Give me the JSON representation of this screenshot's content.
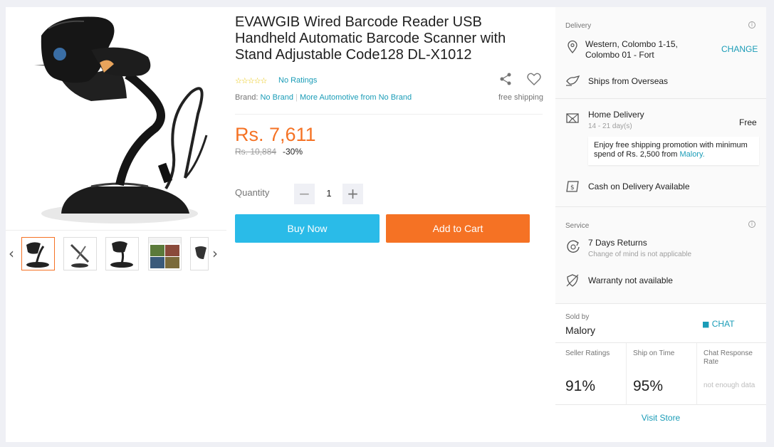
{
  "product": {
    "title": "EVAWGIB Wired Barcode Reader USB Handheld Automatic Barcode Scanner with Stand Adjustable Code128 DL-X1012",
    "ratings_text": "No Ratings",
    "brand_label": "Brand:",
    "brand_name": "No Brand",
    "brand_separator": "|",
    "more_from": "More Automotive from No Brand",
    "free_shipping": "free shipping",
    "price": "Rs. 7,611",
    "original_price": "Rs. 10,884",
    "discount": "-30%",
    "quantity_label": "Quantity",
    "quantity_value": "1",
    "buy_now_label": "Buy Now",
    "add_to_cart_label": "Add to Cart",
    "thumbnail_count": 5
  },
  "delivery": {
    "section_title": "Delivery",
    "location_line1": "Western, Colombo 1-15,",
    "location_line2": "Colombo 01 - Fort",
    "change_label": "CHANGE",
    "ships_from": "Ships from Overseas",
    "home_delivery": "Home Delivery",
    "home_delivery_days": "14 - 21 day(s)",
    "home_delivery_price": "Free",
    "promo_text": "Enjoy free shipping promotion with minimum spend of Rs. 2,500 from",
    "promo_seller": "Malory.",
    "cod": "Cash on Delivery Available"
  },
  "service": {
    "section_title": "Service",
    "returns": "7 Days Returns",
    "returns_sub": "Change of mind is not applicable",
    "warranty": "Warranty not available"
  },
  "seller": {
    "sold_by_label": "Sold by",
    "name": "Malory",
    "chat_label": "CHAT",
    "ratings_label": "Seller Ratings",
    "ratings_value": "91%",
    "ship_on_time_label": "Ship on Time",
    "ship_on_time_value": "95%",
    "chat_response_label": "Chat Response Rate",
    "chat_response_value": "not enough data",
    "visit_store": "Visit Store"
  },
  "colors": {
    "accent_orange": "#f57224",
    "accent_blue": "#2abbe8",
    "link": "#1a9cb7"
  }
}
